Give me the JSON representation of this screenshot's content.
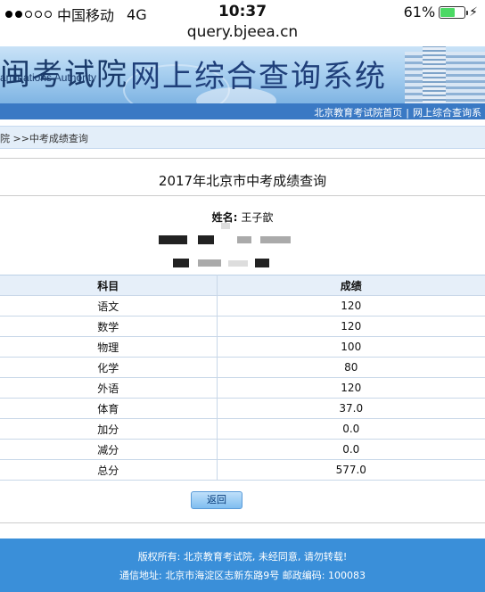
{
  "status_bar": {
    "carrier": "中国移动",
    "network": "4G",
    "time": "10:37",
    "battery_pct": "61%",
    "battery_level": 0.61,
    "icons": [
      "signal-dots-icon",
      "battery-icon",
      "charging-bolt-icon"
    ]
  },
  "browser": {
    "url": "query.bjeea.cn"
  },
  "banner": {
    "seal_text": "闽考试院",
    "authority_text": "aminations Authority",
    "system_title": "网上综合查询系统"
  },
  "nav": {
    "links": [
      "北京教育考试院首页",
      "网上综合查询系"
    ],
    "separator": "|"
  },
  "breadcrumb": {
    "text": "院 >>中考成绩查询"
  },
  "query": {
    "title": "2017年北京市中考成绩查询",
    "name_label": "姓名:",
    "name_value": "王子歆"
  },
  "scores": {
    "headers": [
      "科目",
      "成绩"
    ],
    "rows": [
      [
        "语文",
        "120"
      ],
      [
        "数学",
        "120"
      ],
      [
        "物理",
        "100"
      ],
      [
        "化学",
        "80"
      ],
      [
        "外语",
        "120"
      ],
      [
        "体育",
        "37.0"
      ],
      [
        "加分",
        "0.0"
      ],
      [
        "减分",
        "0.0"
      ],
      [
        "总分",
        "577.0"
      ]
    ]
  },
  "back_button": "返回",
  "footer": {
    "line1": "版权所有: 北京教育考试院, 未经同意, 请勿转载!",
    "line2": "通信地址: 北京市海淀区志新东路9号 邮政编码: 100083"
  },
  "colors": {
    "nav_bar": "#3a79c4",
    "footer": "#3a8fd9",
    "table_header": "#e6eff9",
    "battery": "#4cd964"
  }
}
